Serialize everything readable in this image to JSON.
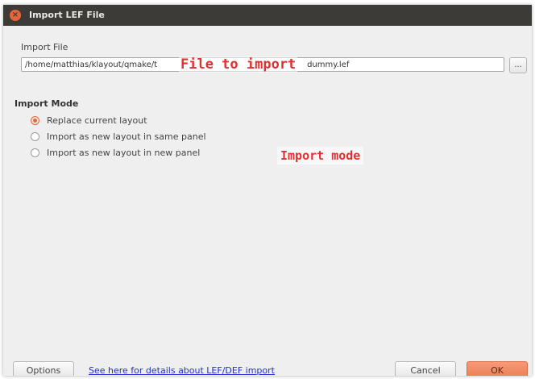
{
  "window": {
    "title": "Import LEF File",
    "close_glyph": "×"
  },
  "import_file": {
    "label": "Import File",
    "path_value": "/home/matthias/klayout/qmake/t",
    "path_suffix": "dummy.lef",
    "browse_label": "..."
  },
  "import_mode": {
    "title": "Import Mode",
    "options": [
      {
        "label": "Replace current layout",
        "checked": true
      },
      {
        "label": "Import as new layout in same panel",
        "checked": false
      },
      {
        "label": "Import as new layout in new panel",
        "checked": false
      }
    ]
  },
  "annotations": {
    "file": "File to import",
    "mode": "Import mode",
    "color": "#e03030"
  },
  "footer": {
    "options_label": "Options",
    "details_link": "See here for details about LEF/DEF import",
    "cancel_label": "Cancel",
    "ok_label": "OK"
  },
  "colors": {
    "titlebar": "#3c3b37",
    "accent": "#e06a43",
    "link": "#1f2fd0"
  }
}
